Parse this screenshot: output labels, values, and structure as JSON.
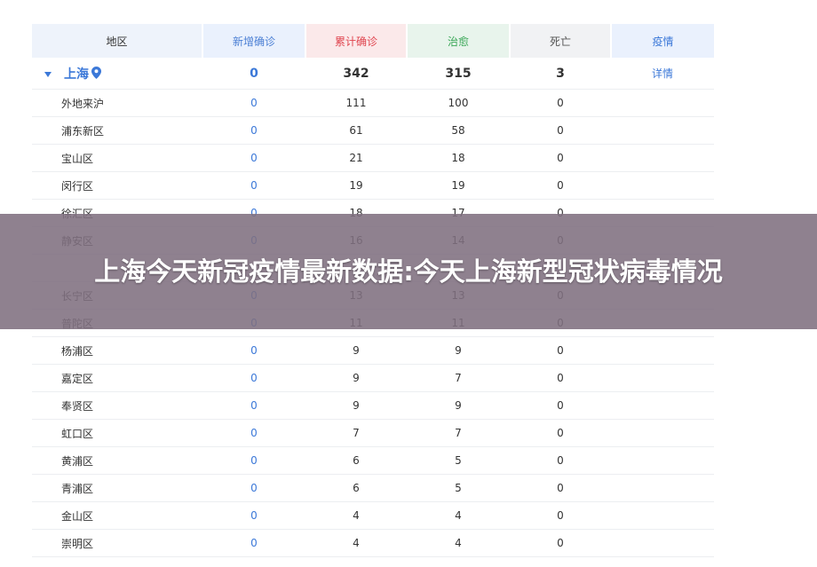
{
  "table": {
    "headers": {
      "region": "地区",
      "new": "新增确诊",
      "total": "累计确诊",
      "cured": "治愈",
      "dead": "死亡",
      "info": "疫情"
    },
    "province": {
      "name": "上海",
      "new": "0",
      "total": "342",
      "cured": "315",
      "dead": "3",
      "link": "详情"
    },
    "rows": [
      {
        "name": "外地来沪",
        "new": "0",
        "total": "111",
        "cured": "100",
        "dead": "0"
      },
      {
        "name": "浦东新区",
        "new": "0",
        "total": "61",
        "cured": "58",
        "dead": "0"
      },
      {
        "name": "宝山区",
        "new": "0",
        "total": "21",
        "cured": "18",
        "dead": "0"
      },
      {
        "name": "闵行区",
        "new": "0",
        "total": "19",
        "cured": "19",
        "dead": "0"
      },
      {
        "name": "徐汇区",
        "new": "0",
        "total": "18",
        "cured": "17",
        "dead": "0"
      },
      {
        "name": "静安区",
        "new": "0",
        "total": "16",
        "cured": "14",
        "dead": "0"
      },
      {
        "name": "",
        "new": "",
        "total": "",
        "cured": "",
        "dead": ""
      },
      {
        "name": "长宁区",
        "new": "0",
        "total": "13",
        "cured": "13",
        "dead": "0"
      },
      {
        "name": "普陀区",
        "new": "0",
        "total": "11",
        "cured": "11",
        "dead": "0"
      },
      {
        "name": "杨浦区",
        "new": "0",
        "total": "9",
        "cured": "9",
        "dead": "0"
      },
      {
        "name": "嘉定区",
        "new": "0",
        "total": "9",
        "cured": "7",
        "dead": "0"
      },
      {
        "name": "奉贤区",
        "new": "0",
        "total": "9",
        "cured": "9",
        "dead": "0"
      },
      {
        "name": "虹口区",
        "new": "0",
        "total": "7",
        "cured": "7",
        "dead": "0"
      },
      {
        "name": "黄浦区",
        "new": "0",
        "total": "6",
        "cured": "5",
        "dead": "0"
      },
      {
        "name": "青浦区",
        "new": "0",
        "total": "6",
        "cured": "5",
        "dead": "0"
      },
      {
        "name": "金山区",
        "new": "0",
        "total": "4",
        "cured": "4",
        "dead": "0"
      },
      {
        "name": "崇明区",
        "new": "0",
        "total": "4",
        "cured": "4",
        "dead": "0"
      }
    ]
  },
  "banner": {
    "title": "上海今天新冠疫情最新数据:今天上海新型冠状病毒情况"
  },
  "colors": {
    "accent_blue": "#3b78d8",
    "total_red": "#e0454f",
    "cured_green": "#3aa757",
    "banner_bg": "#807080"
  }
}
